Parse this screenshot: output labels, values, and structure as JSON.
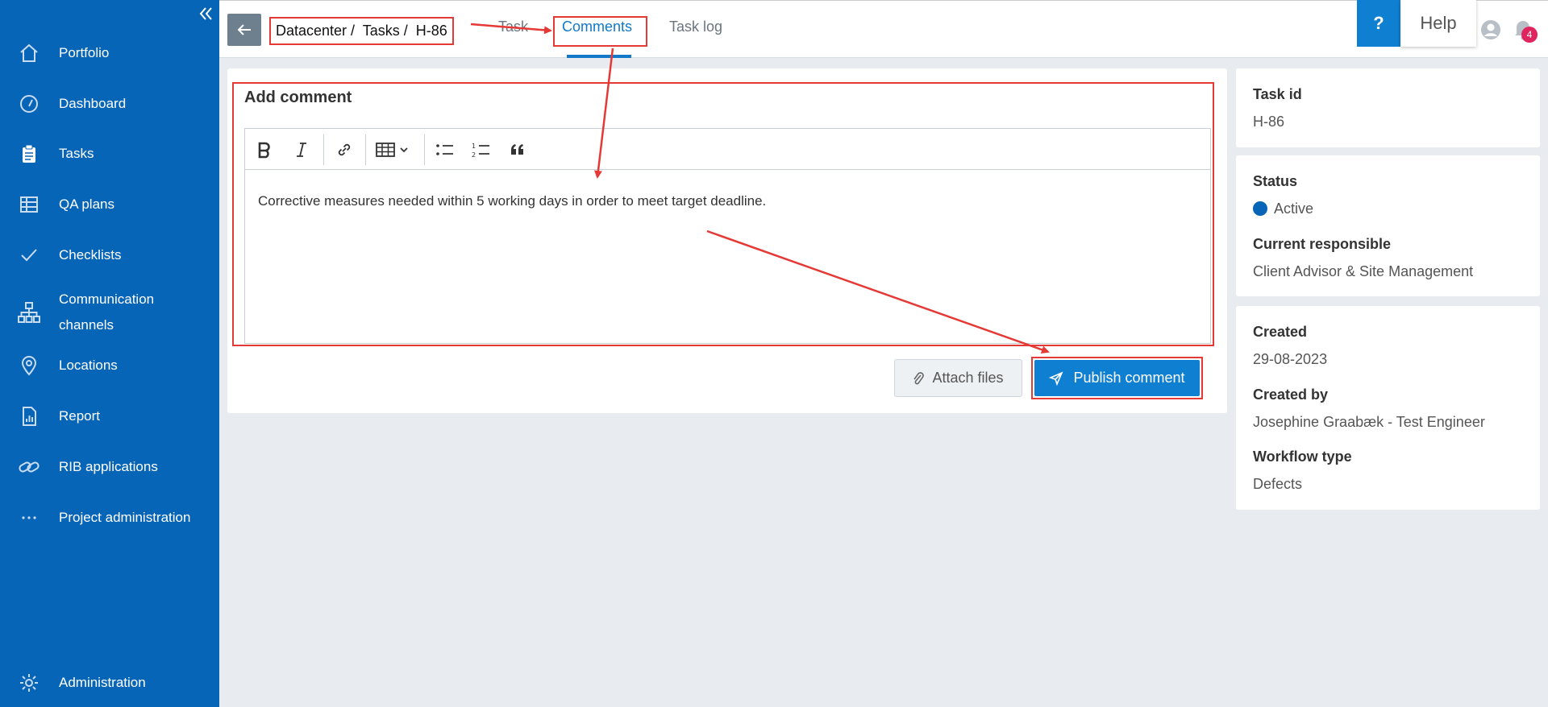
{
  "sidebar": {
    "items": [
      {
        "label": "Portfolio",
        "icon": "home-icon"
      },
      {
        "label": "Dashboard",
        "icon": "gauge-icon"
      },
      {
        "label": "Tasks",
        "icon": "clipboard-icon"
      },
      {
        "label": "QA plans",
        "icon": "table-icon"
      },
      {
        "label": "Checklists",
        "icon": "check-icon"
      },
      {
        "label": "Communication channels",
        "icon": "network-icon"
      },
      {
        "label": "Locations",
        "icon": "location-pin-icon"
      },
      {
        "label": "Report",
        "icon": "report-icon"
      },
      {
        "label": "RIB applications",
        "icon": "link-icon"
      },
      {
        "label": "Project administration",
        "icon": "more-icon"
      },
      {
        "label": "Administration",
        "icon": "gear-icon"
      }
    ],
    "active": "Tasks"
  },
  "header": {
    "breadcrumb": "Datacenter /  Tasks /  H-86",
    "tabs": [
      {
        "label": "Task"
      },
      {
        "label": "Comments"
      },
      {
        "label": "Task log"
      }
    ],
    "active_tab": "Comments",
    "help_symbol": "?",
    "help_label": "Help",
    "notification_count": "4"
  },
  "comment": {
    "title": "Add comment",
    "text": "Corrective measures needed within 5 working days in order to meet target deadline.",
    "attach_label": "Attach files",
    "publish_label": "Publish comment"
  },
  "details": {
    "task_id_label": "Task id",
    "task_id": "H-86",
    "status_label": "Status",
    "status": "Active",
    "responsible_label": "Current responsible",
    "responsible": "Client Advisor & Site Management",
    "created_label": "Created",
    "created": "29-08-2023",
    "created_by_label": "Created by",
    "created_by": "Josephine Graabæk - Test Engineer",
    "workflow_label": "Workflow type",
    "workflow": "Defects"
  },
  "colors": {
    "sidebar": "#0765b8",
    "accent": "#0f7fd1",
    "annotation": "#e53935",
    "badge": "#e0245e"
  }
}
